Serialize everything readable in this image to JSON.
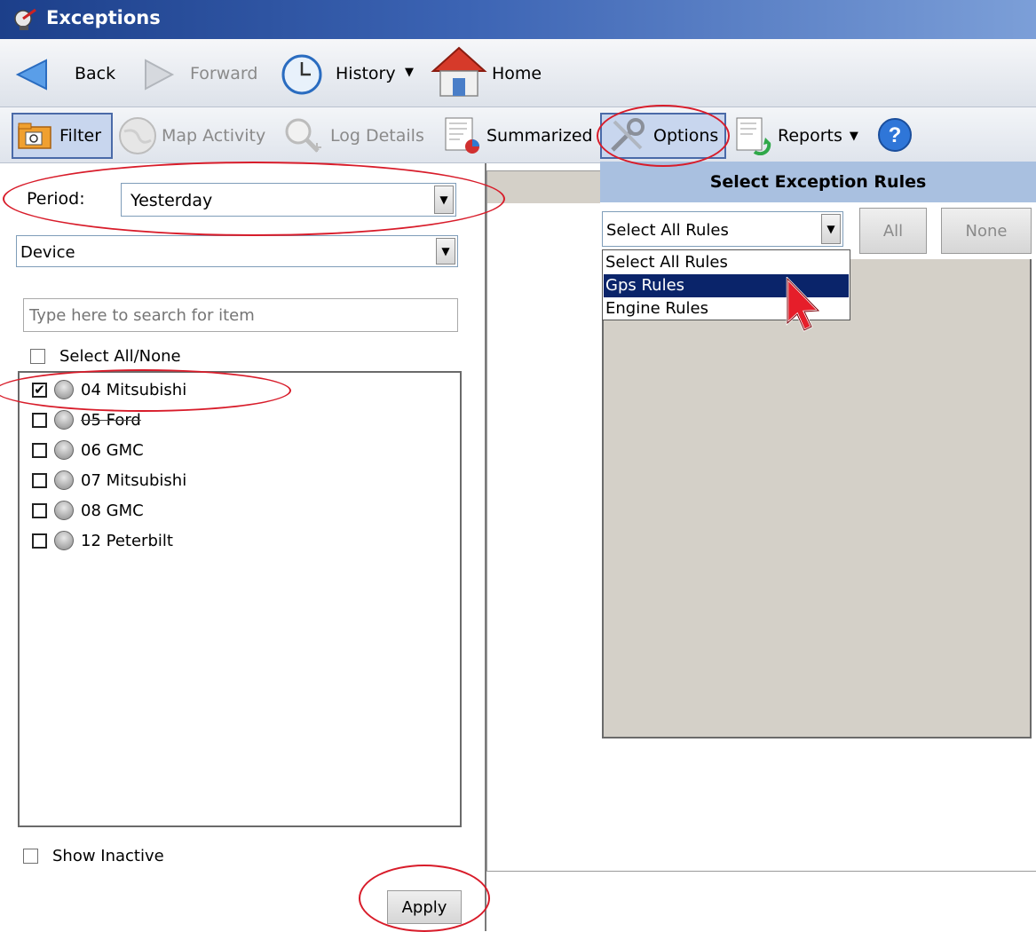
{
  "window": {
    "title": "Exceptions"
  },
  "nav": {
    "back": "Back",
    "forward": "Forward",
    "history": "History",
    "home": "Home"
  },
  "toolbar": {
    "filter": "Filter",
    "map_activity": "Map Activity",
    "log_details": "Log Details",
    "summarized": "Summarized",
    "options": "Options",
    "reports": "Reports"
  },
  "filter": {
    "period_label": "Period:",
    "period_value": "Yesterday",
    "group_value": "Device",
    "search_placeholder": "Type here to search for item",
    "select_all_label": "Select All/None",
    "show_inactive_label": "Show Inactive",
    "apply_label": "Apply",
    "devices": [
      {
        "name": "04 Mitsubishi",
        "checked": true
      },
      {
        "name": "05 Ford",
        "checked": false
      },
      {
        "name": "06 GMC",
        "checked": false
      },
      {
        "name": "07 Mitsubishi",
        "checked": false
      },
      {
        "name": "08 GMC",
        "checked": false
      },
      {
        "name": "12 Peterbilt",
        "checked": false
      }
    ]
  },
  "options": {
    "header": "Select Exception Rules",
    "rules_select_value": "Select All Rules",
    "all_button": "All",
    "none_button": "None",
    "rules_options": [
      "Select All Rules",
      "Gps Rules",
      "Engine Rules"
    ],
    "rules_highlighted": "Gps Rules"
  },
  "colors": {
    "annotation_ring": "#d81c2a",
    "selection": "#0a246a",
    "title_bar": "#1c3f8a"
  }
}
